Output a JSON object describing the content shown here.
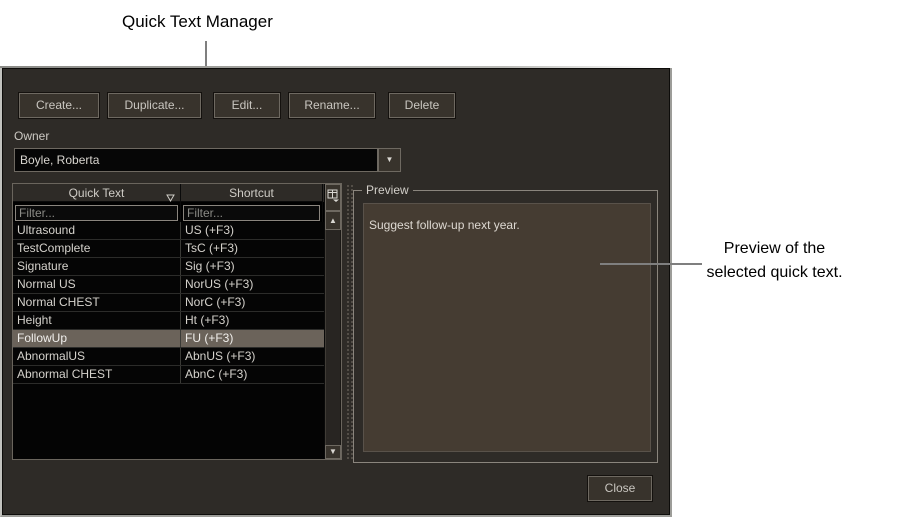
{
  "annotations": {
    "title": "Quick Text Manager",
    "preview_note": "Preview of the selected quick text."
  },
  "toolbar": {
    "create_label": "Create...",
    "duplicate_label": "Duplicate...",
    "edit_label": "Edit...",
    "rename_label": "Rename...",
    "delete_label": "Delete"
  },
  "owner": {
    "label": "Owner",
    "value": "Boyle, Roberta"
  },
  "table": {
    "columns": [
      {
        "label": "Quick Text",
        "sorted": true
      },
      {
        "label": "Shortcut",
        "sorted": false
      }
    ],
    "filter_placeholder": "Filter...",
    "rows": [
      {
        "quick_text": "Ultrasound",
        "shortcut": "US (+F3)",
        "selected": false
      },
      {
        "quick_text": "TestComplete",
        "shortcut": "TsC (+F3)",
        "selected": false
      },
      {
        "quick_text": "Signature",
        "shortcut": "Sig (+F3)",
        "selected": false
      },
      {
        "quick_text": "Normal US",
        "shortcut": "NorUS (+F3)",
        "selected": false
      },
      {
        "quick_text": "Normal CHEST",
        "shortcut": "NorC (+F3)",
        "selected": false
      },
      {
        "quick_text": "Height",
        "shortcut": "Ht (+F3)",
        "selected": false
      },
      {
        "quick_text": "FollowUp",
        "shortcut": "FU (+F3)",
        "selected": true
      },
      {
        "quick_text": "AbnormalUS",
        "shortcut": "AbnUS (+F3)",
        "selected": false
      },
      {
        "quick_text": "Abnormal CHEST",
        "shortcut": "AbnC (+F3)",
        "selected": false
      }
    ]
  },
  "preview": {
    "label": "Preview",
    "text": "Suggest follow-up next year."
  },
  "footer": {
    "close_label": "Close"
  },
  "colors": {
    "dialog_bg": "#2e2b27",
    "selection_bg": "#6b635a",
    "preview_box_bg": "#453c32",
    "callout_line": "#7f7f7f",
    "table_bg": "#050505"
  }
}
